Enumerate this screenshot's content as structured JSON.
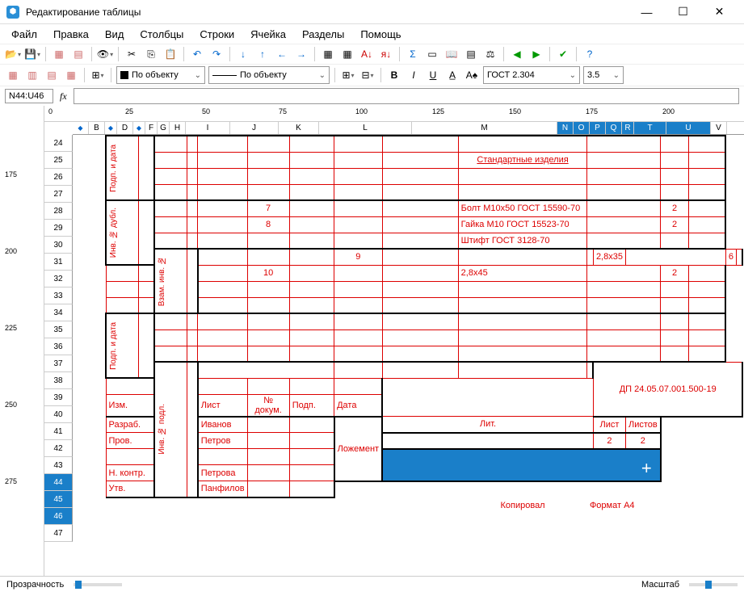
{
  "window": {
    "title": "Редактирование таблицы"
  },
  "menu": {
    "file": "Файл",
    "edit": "Правка",
    "view": "Вид",
    "cols": "Столбцы",
    "rows": "Строки",
    "cell": "Ячейка",
    "sections": "Разделы",
    "help": "Помощь"
  },
  "combo1": "По объекту",
  "combo2": "По объекту",
  "font": "ГОСТ 2.304",
  "fontsize": "3.5",
  "cellref": "N44:U46",
  "ruler": {
    "h": [
      0,
      25,
      50,
      75,
      100,
      125,
      150,
      175,
      200
    ],
    "v": [
      175,
      200,
      225,
      250,
      275
    ]
  },
  "cols": [
    "B",
    "D",
    "F",
    "G",
    "H",
    "I",
    "J",
    "K",
    "L",
    "M",
    "N",
    "O",
    "P",
    "Q",
    "R",
    "T",
    "U",
    "V"
  ],
  "rows": [
    24,
    25,
    26,
    27,
    28,
    29,
    30,
    31,
    32,
    33,
    34,
    35,
    36,
    37,
    38,
    39,
    40,
    41,
    42,
    43,
    44,
    45,
    46,
    47
  ],
  "tb": {
    "std_header": "Стандартные изделия",
    "r1": {
      "pos": "7",
      "name": "Болт М10х50 ГОСТ 15590-70",
      "qty": "2"
    },
    "r2": {
      "pos": "8",
      "name": "Гайка М10 ГОСТ 15523-70",
      "qty": "2"
    },
    "r3": {
      "name": "Штифт ГОСТ 3128-70"
    },
    "r4": {
      "pos": "9",
      "name": "2,8х35",
      "qty": "6"
    },
    "r5": {
      "pos": "10",
      "name": "2,8х45",
      "qty": "2"
    },
    "sidebar": {
      "s1": "Подп. и дата",
      "s2": "Инв. № дубл.",
      "s3": "Взам. инв. №",
      "s4": "Подп. и дата",
      "s5": "Инв. № подл."
    },
    "hdr": {
      "izm": "Изм.",
      "list": "Лист",
      "docnum": "№ докум.",
      "sign": "Подп.",
      "date": "Дата"
    },
    "roles": {
      "dev": "Разраб.",
      "chk": "Пров.",
      "nctrl": "Н. контр.",
      "appr": "Утв."
    },
    "names": {
      "dev": "Иванов",
      "chk": "Петров",
      "nctrl": "Петрова",
      "appr": "Панфилов"
    },
    "docnum": "ДП 24.05.07.001.500-19",
    "partname": "Ложемент",
    "lit": "Лит.",
    "sheet": "Лист",
    "sheets": "Листов",
    "sheetnum": "2",
    "sheetstotal": "2",
    "copy": "Копировал",
    "format": "Формат А4"
  },
  "status": {
    "transparency": "Прозрачность",
    "scale": "Масштаб"
  }
}
